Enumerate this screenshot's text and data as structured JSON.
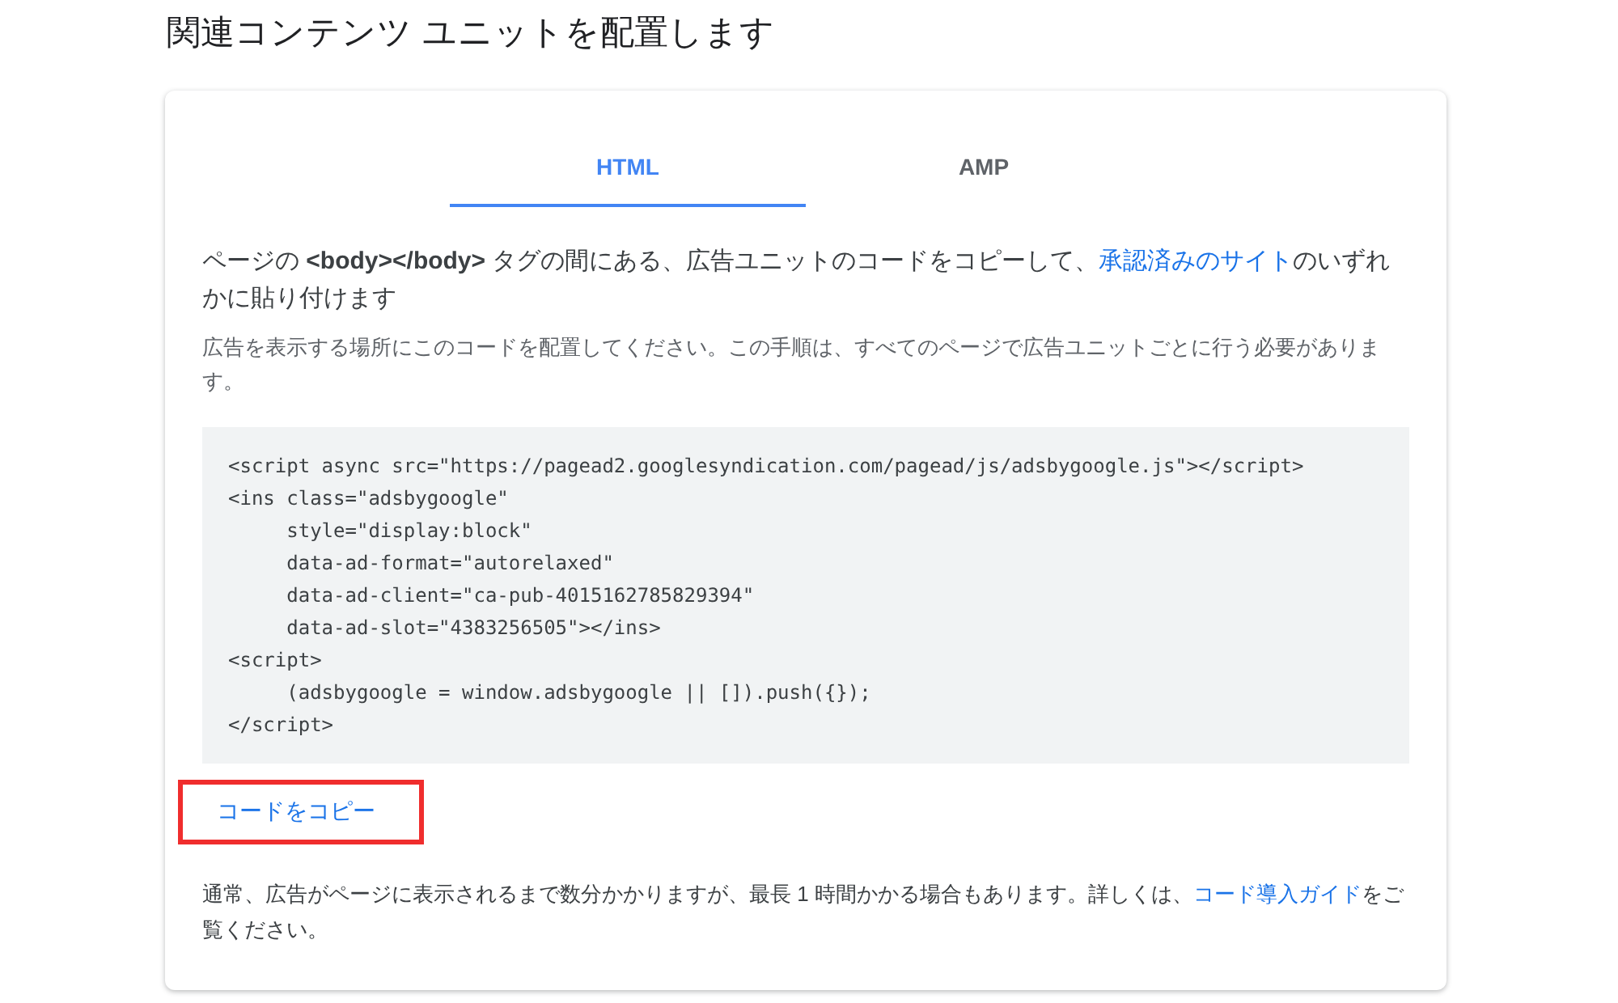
{
  "page_title": "関連コンテンツ ユニットを配置します",
  "tabs": [
    {
      "label": "HTML",
      "selected": true
    },
    {
      "label": "AMP",
      "selected": false
    }
  ],
  "instruction": [
    {
      "kind": "text",
      "text": "ページの "
    },
    {
      "kind": "bold",
      "text": "<body></body>"
    },
    {
      "kind": "text",
      "text": " タグの間にある、広告ユニットのコードをコピーして、"
    },
    {
      "kind": "link",
      "text": "承認済みのサイト"
    },
    {
      "kind": "text",
      "text": "のいずれかに貼り付けます"
    }
  ],
  "note": "広告を表示する場所にこのコードを配置してください。この手順は、すべてのページで広告ユニットごとに行う必要があります。",
  "code_lines": [
    "<script async src=\"https://pagead2.googlesyndication.com/pagead/js/adsbygoogle.js\"></script>",
    "<ins class=\"adsbygoogle\"",
    "     style=\"display:block\"",
    "     data-ad-format=\"autorelaxed\"",
    "     data-ad-client=\"ca-pub-4015162785829394\"",
    "     data-ad-slot=\"4383256505\"></ins>",
    "<script>",
    "     (adsbygoogle = window.adsbygoogle || []).push({});",
    "</script>"
  ],
  "copy_button": {
    "label": "コードをコピー",
    "highlighted": true
  },
  "footer": [
    {
      "kind": "text",
      "text": "通常、広告がページに表示されるまで数分かかりますが、最長 1 時間かかる場合もあります。詳しくは、"
    },
    {
      "kind": "link",
      "text": "コード導入ガイド"
    },
    {
      "kind": "text",
      "text": "をご覧ください。"
    }
  ]
}
